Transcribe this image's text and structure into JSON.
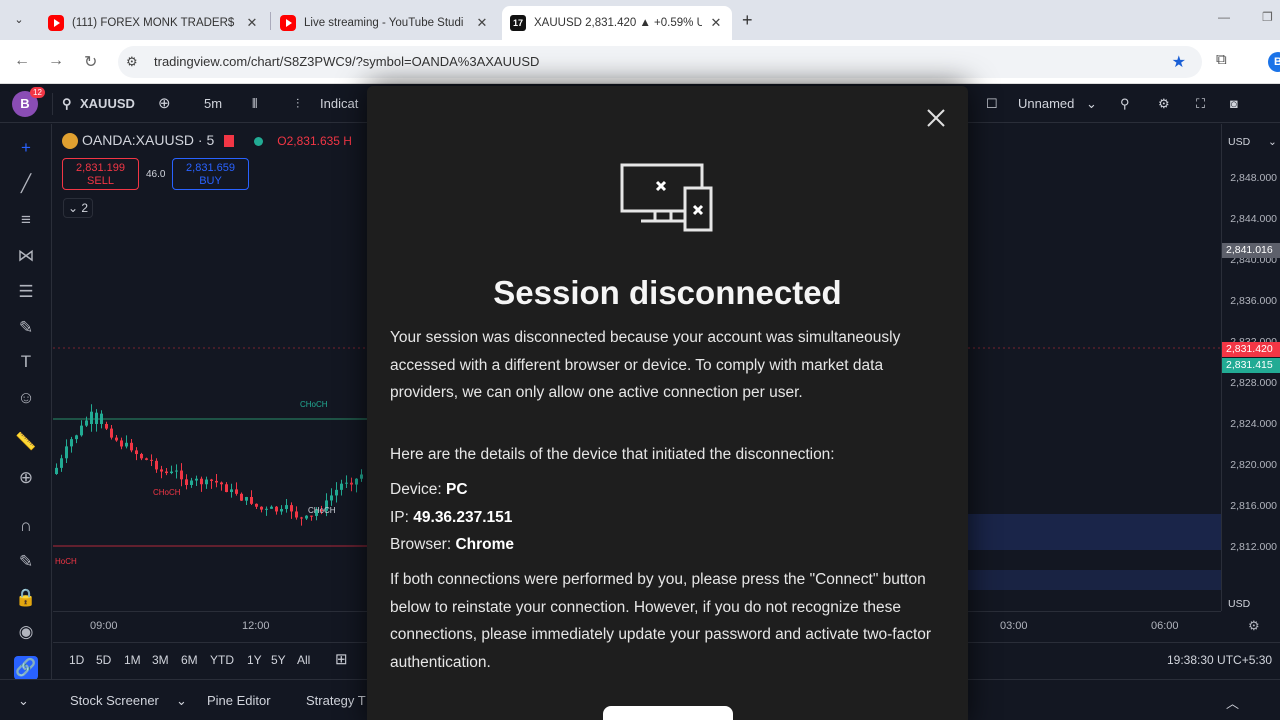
{
  "browser": {
    "tabs": [
      {
        "title": "(111) FOREX MONK TRADER$ -",
        "icon": "youtube-icon"
      },
      {
        "title": "Live streaming - YouTube Studi",
        "icon": "youtube-icon"
      },
      {
        "title": "XAUUSD 2,831.420 ▲ +0.59% Ur",
        "icon": "tradingview-icon"
      }
    ],
    "url": "tradingview.com/chart/S8Z3PWC9/?symbol=OANDA%3AXAUUSD",
    "profile_letter": "B"
  },
  "tv": {
    "avatar_letter": "B",
    "notif_count": "12",
    "symbol_search": "XAUUSD",
    "interval": "5m",
    "indicators_label": "Indicat",
    "layout_name": "Unnamed",
    "legend": {
      "symbol": "OANDA:XAUUSD · 5",
      "ohlc": "O2,831.635 H",
      "sell_price": "2,831.199",
      "sell_label": "SELL",
      "spread": "46.0",
      "buy_price": "2,831.659",
      "buy_label": "BUY",
      "collapse_count": "2"
    },
    "currency": "USD",
    "price_ticks": [
      "2,848.000",
      "2,844.000",
      "2,840.000",
      "2,836.000",
      "2,832.000",
      "2,828.000",
      "2,824.000",
      "2,820.000",
      "2,816.000",
      "2,812.000"
    ],
    "price_labels": {
      "gray": "2,841.016",
      "red": "2,831.420",
      "green": "2,831.415"
    },
    "chart_annotations": [
      "CHoCH",
      "CHoCH",
      "CHoCH",
      "HoCH"
    ],
    "time_ticks": [
      "09:00",
      "12:00",
      "03:00",
      "06:00"
    ],
    "ranges": [
      "1D",
      "5D",
      "1M",
      "3M",
      "6M",
      "YTD",
      "1Y",
      "5Y",
      "All"
    ],
    "clock": "19:38:30 UTC+5:30",
    "bottom_tabs": [
      "Stock Screener",
      "Pine Editor",
      "Strategy T"
    ]
  },
  "modal": {
    "title": "Session disconnected",
    "p1": "Your session was disconnected because your account was simultaneously accessed with a different browser or device. To comply with market data providers, we can only allow one active connection per user.",
    "p2": "Here are the details of the device that initiated the disconnection:",
    "device_label": "Device: ",
    "device_value": "PC",
    "ip_label": "IP: ",
    "ip_value": "49.36.237.151",
    "browser_label": "Browser: ",
    "browser_value": "Chrome",
    "p3": "If both connections were performed by you, please press the \"Connect\" button below to reinstate your connection. However, if you do not recognize these connections, please immediately update your password and activate two-factor authentication."
  }
}
